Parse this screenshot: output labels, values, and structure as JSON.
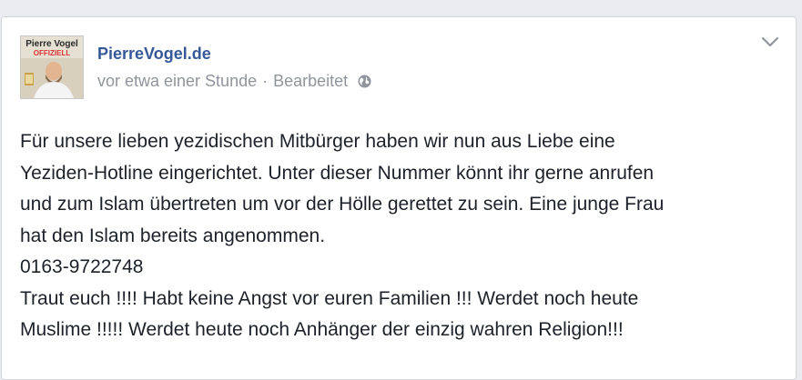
{
  "post": {
    "avatar_text_top": "Pierre Vogel",
    "avatar_text_bottom": "OFFIZIELL",
    "author": "PierreVogel.de",
    "timestamp": "vor etwa einer Stunde",
    "separator": "·",
    "edited_label": "Bearbeitet",
    "privacy_icon": "globe-icon",
    "menu_icon": "chevron-down-icon",
    "lines": [
      "Für unsere lieben yezidischen Mitbürger haben wir nun aus Liebe eine",
      "Yeziden-Hotline eingerichtet. Unter dieser Nummer könnt ihr gerne anrufen",
      "und zum Islam übertreten um vor der Hölle gerettet zu sein. Eine junge Frau",
      "hat den Islam bereits angenommen.",
      "0163-9722748",
      "Traut euch !!!! Habt keine Angst vor euren Familien !!! Werdet noch heute",
      "Muslime !!!!! Werdet heute noch Anhänger der einzig wahren Religion!!!"
    ]
  },
  "colors": {
    "author_link": "#365899",
    "meta_text": "#90949c",
    "body_text": "#1d2129",
    "card_border": "#d3d6db",
    "background": "#e9ebee"
  }
}
